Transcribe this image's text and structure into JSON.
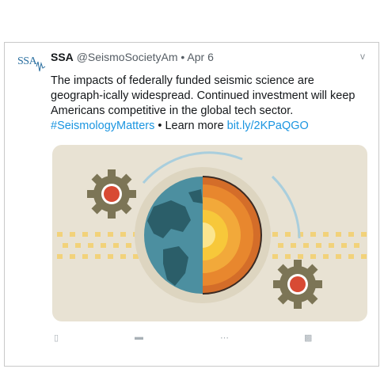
{
  "tweet": {
    "avatar_text": "SSA",
    "display_name": "SSA",
    "handle": "@SeismoSocietyAm",
    "separator": " • ",
    "date": "Apr 6",
    "menu_glyph": "v",
    "text_main": "The impacts of federally funded seismic science are geograph-ically widespread. Continued investment will keep Americans competitive in the global tech sector. ",
    "hashtag": "#SeismologyMatters",
    "text_mid": " • Learn more ",
    "link": "bit.ly/2KPaQGO"
  },
  "media": {
    "background": "#e8e2d3",
    "colors": {
      "gear": "#7c7556",
      "gear_ring": "#d84a34",
      "globe_ocean": "#4c8fa0",
      "globe_land": "#2b5e69",
      "crust": "#d46d29",
      "mantle_outer": "#e8872e",
      "mantle_inner": "#f2a93a",
      "outer_core": "#f7c83a",
      "inner_core": "#fbe58e",
      "waves": "#f2d27a",
      "arc": "#a9cedd"
    }
  },
  "actions": [
    {
      "icon": "reply-icon"
    },
    {
      "icon": "retweet-icon"
    },
    {
      "icon": "like-icon"
    },
    {
      "icon": "share-icon"
    }
  ]
}
